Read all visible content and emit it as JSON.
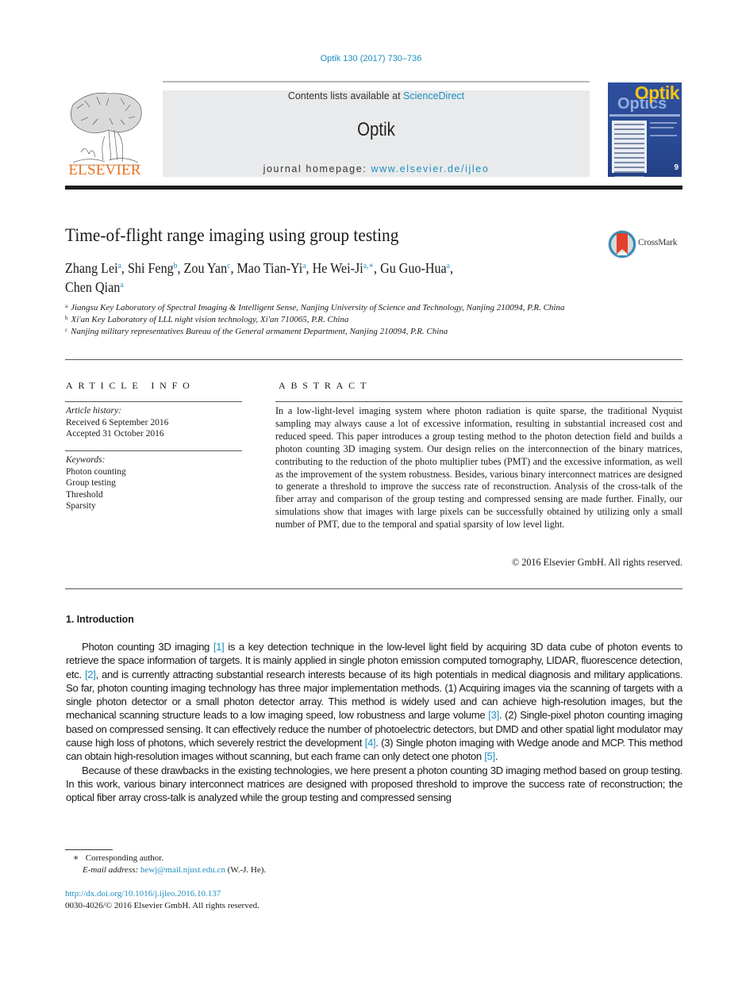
{
  "header": {
    "journal_reference": "Optik 130 (2017) 730–736",
    "contents_prefix": "Contents lists available at ",
    "contents_link": "ScienceDirect",
    "journal_name": "Optik",
    "homepage_prefix": "journal homepage: ",
    "homepage_link": "www.elsevier.de/ijleo",
    "publisher_logo": "ELSEVIER",
    "cover": {
      "title_top": "Optik",
      "title_bottom": "Optics",
      "issue_number": "9"
    },
    "crossmark_label": "CrossMark"
  },
  "colors": {
    "link": "#1f8fc0",
    "elsevier_orange": "#e9711c",
    "banner_bg": "#e9eaeb"
  },
  "article": {
    "title": "Time-of-flight range imaging using group testing",
    "authors": [
      {
        "name": "Zhang Lei",
        "aff": "a"
      },
      {
        "name": "Shi Feng",
        "aff": "b"
      },
      {
        "name": "Zou Yan",
        "aff": "c"
      },
      {
        "name": "Mao Tian-Yi",
        "aff": "a"
      },
      {
        "name": "He Wei-Ji",
        "aff": "a,∗"
      },
      {
        "name": "Gu Guo-Hua",
        "aff": "a"
      },
      {
        "name": "Chen Qian",
        "aff": "a"
      }
    ],
    "affiliations": [
      {
        "key": "a",
        "text": "Jiangsu Key Laboratory of Spectral Imaging & Intelligent Sense, Nanjing University of Science and Technology, Nanjing 210094, P.R. China"
      },
      {
        "key": "b",
        "text": "Xi'an Key Laboratory of LLL night vision technology, Xi'an 710065, P.R. China"
      },
      {
        "key": "c",
        "text": "Nanjing military representatives Bureau of the General armament Department, Nanjing 210094, P.R. China"
      }
    ]
  },
  "article_info": {
    "heading": "ARTICLE INFO",
    "history_label": "Article history:",
    "received": "Received 6 September 2016",
    "accepted": "Accepted 31 October 2016",
    "keywords_label": "Keywords:",
    "keywords": [
      "Photon counting",
      "Group testing",
      "Threshold",
      "Sparsity"
    ]
  },
  "abstract": {
    "heading": "ABSTRACT",
    "text": "In a low-light-level imaging system where photon radiation is quite sparse, the traditional Nyquist sampling may always cause a lot of excessive information, resulting in substantial increased cost and reduced speed. This paper introduces a group testing method to the photon detection field and builds a  photon counting 3D imaging system. Our design relies on the interconnection of the binary matrices, contributing to the reduction of the photo multiplier tubes (PMT) and the excessive information, as well as the improvement of the system robustness. Besides, various binary interconnect matrices are designed to generate a threshold to improve the success rate of reconstruction. Analysis of the cross-talk of the fiber array and comparison of the group testing and compressed sensing are made further. Finally, our simulations show that images with large pixels can be successfully obtained by utilizing only a small number of PMT, due to the temporal and spatial sparsity of low level light.",
    "copyright": "© 2016 Elsevier GmbH. All rights reserved."
  },
  "introduction": {
    "heading": "1.  Introduction",
    "p1": [
      "Photon counting 3D imaging ",
      "[1]",
      " is a key detection technique in the low-level light field by acquiring 3D data cube of photon events to retrieve the space information of targets. It is mainly applied in single photon emission computed tomography, LIDAR, fluorescence detection, etc. ",
      "[2]",
      ", and is currently attracting substantial research interests because of its high potentials in medical diagnosis and military applications. So far, photon counting imaging technology has three major implementation methods. (1) Acquiring images via the scanning of targets with a single photon detector or a small photon detector array. This method is widely used and can achieve high-resolution images, but the mechanical scanning structure leads to a low imaging speed, low robustness and large volume ",
      "[3]",
      ". (2) Single-pixel photon counting imaging based on compressed sensing. It can effectively reduce the number of photoelectric detectors, but DMD and other spatial light modulator may cause high loss of photons, which severely restrict the development ",
      "[4]",
      ". (3) Single photon imaging with Wedge anode and MCP. This method can obtain high-resolution images without scanning, but each frame can only detect one photon ",
      "[5]",
      "."
    ],
    "p2": "Because of these drawbacks in the existing technologies, we here present a photon counting 3D imaging method based on group testing. In this work, various binary interconnect matrices are designed with proposed threshold to improve the success rate of reconstruction; the optical fiber array cross-talk is analyzed while the group testing and compressed sensing"
  },
  "footnotes": {
    "star": "∗",
    "corresponding": "Corresponding author.",
    "email_label": "E-mail address: ",
    "email": "hewj@mail.njust.edu.cn",
    "email_suffix": " (W.-J. He).",
    "doi": "http://dx.doi.org/10.1016/j.ijleo.2016.10.137",
    "issn_line": "0030-4026/© 2016 Elsevier GmbH. All rights reserved."
  }
}
